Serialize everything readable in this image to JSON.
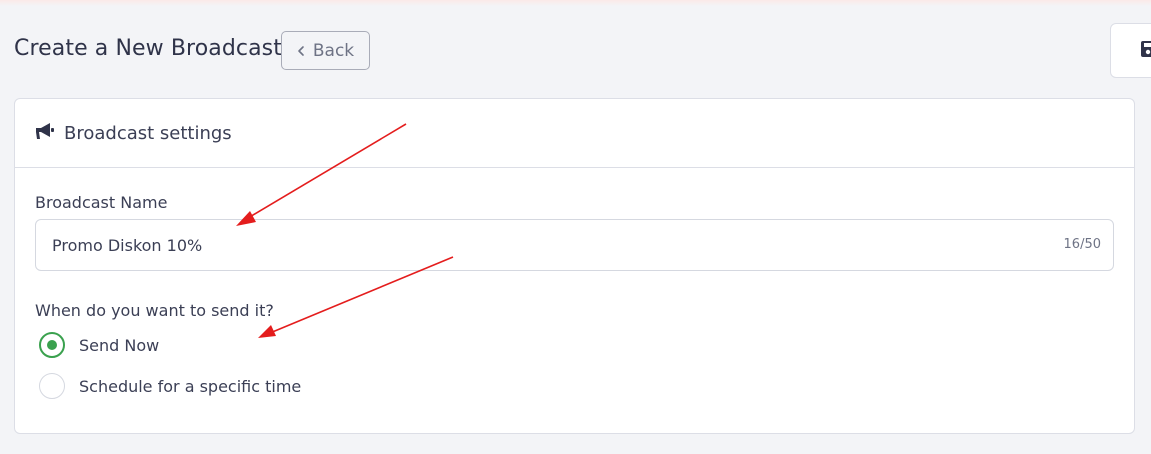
{
  "header": {
    "title": "Create a New Broadcast",
    "back_label": "Back",
    "save_icon": "save-icon"
  },
  "card": {
    "title": "Broadcast settings",
    "icon": "megaphone-icon"
  },
  "broadcast_name": {
    "label": "Broadcast Name",
    "value": "Promo Diskon 10%",
    "char_count": "16/50"
  },
  "send_time": {
    "label": "When do you want to send it?",
    "options": [
      {
        "label": "Send Now",
        "selected": true
      },
      {
        "label": "Schedule for a specific time",
        "selected": false
      }
    ]
  },
  "colors": {
    "accent_green": "#3aa14e",
    "annotation_red": "#e41d1d",
    "text": "#2f3349"
  }
}
